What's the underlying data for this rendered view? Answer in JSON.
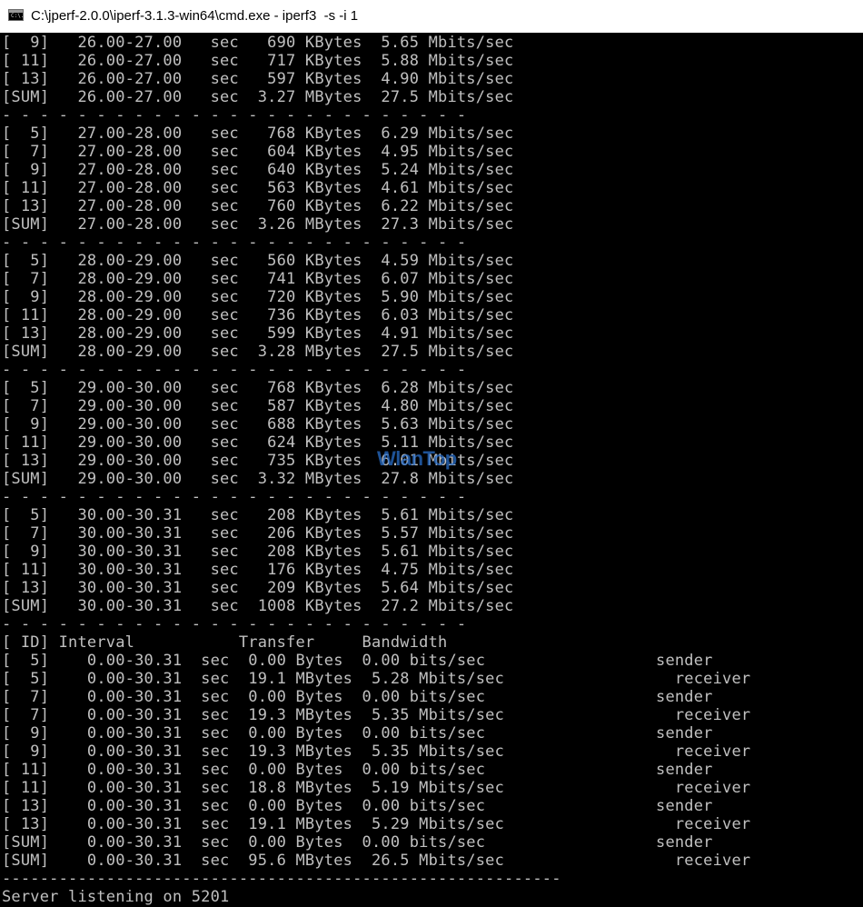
{
  "window": {
    "title": "C:\\jperf-2.0.0\\iperf-3.1.3-win64\\cmd.exe - iperf3  -s -i 1",
    "icon": "cmd-console-icon",
    "icon_glyph": "C:\\."
  },
  "watermark": "WlanTop",
  "console": {
    "lines": [
      "[  9]   26.00-27.00   sec   690 KBytes  5.65 Mbits/sec",
      "[ 11]   26.00-27.00   sec   717 KBytes  5.88 Mbits/sec",
      "[ 13]   26.00-27.00   sec   597 KBytes  4.90 Mbits/sec",
      "[SUM]   26.00-27.00   sec  3.27 MBytes  27.5 Mbits/sec",
      "- - - - - - - - - - - - - - - - - - - - - - - - -",
      "[  5]   27.00-28.00   sec   768 KBytes  6.29 Mbits/sec",
      "[  7]   27.00-28.00   sec   604 KBytes  4.95 Mbits/sec",
      "[  9]   27.00-28.00   sec   640 KBytes  5.24 Mbits/sec",
      "[ 11]   27.00-28.00   sec   563 KBytes  4.61 Mbits/sec",
      "[ 13]   27.00-28.00   sec   760 KBytes  6.22 Mbits/sec",
      "[SUM]   27.00-28.00   sec  3.26 MBytes  27.3 Mbits/sec",
      "- - - - - - - - - - - - - - - - - - - - - - - - -",
      "[  5]   28.00-29.00   sec   560 KBytes  4.59 Mbits/sec",
      "[  7]   28.00-29.00   sec   741 KBytes  6.07 Mbits/sec",
      "[  9]   28.00-29.00   sec   720 KBytes  5.90 Mbits/sec",
      "[ 11]   28.00-29.00   sec   736 KBytes  6.03 Mbits/sec",
      "[ 13]   28.00-29.00   sec   599 KBytes  4.91 Mbits/sec",
      "[SUM]   28.00-29.00   sec  3.28 MBytes  27.5 Mbits/sec",
      "- - - - - - - - - - - - - - - - - - - - - - - - -",
      "[  5]   29.00-30.00   sec   768 KBytes  6.28 Mbits/sec",
      "[  7]   29.00-30.00   sec   587 KBytes  4.80 Mbits/sec",
      "[  9]   29.00-30.00   sec   688 KBytes  5.63 Mbits/sec",
      "[ 11]   29.00-30.00   sec   624 KBytes  5.11 Mbits/sec",
      "[ 13]   29.00-30.00   sec   735 KBytes  6.01 Mbits/sec",
      "[SUM]   29.00-30.00   sec  3.32 MBytes  27.8 Mbits/sec",
      "- - - - - - - - - - - - - - - - - - - - - - - - -",
      "[  5]   30.00-30.31   sec   208 KBytes  5.61 Mbits/sec",
      "[  7]   30.00-30.31   sec   206 KBytes  5.57 Mbits/sec",
      "[  9]   30.00-30.31   sec   208 KBytes  5.61 Mbits/sec",
      "[ 11]   30.00-30.31   sec   176 KBytes  4.75 Mbits/sec",
      "[ 13]   30.00-30.31   sec   209 KBytes  5.64 Mbits/sec",
      "[SUM]   30.00-30.31   sec  1008 KBytes  27.2 Mbits/sec",
      "- - - - - - - - - - - - - - - - - - - - - - - - -",
      "[ ID] Interval           Transfer     Bandwidth",
      "[  5]    0.00-30.31  sec  0.00 Bytes  0.00 bits/sec                  sender",
      "[  5]    0.00-30.31  sec  19.1 MBytes  5.28 Mbits/sec                  receiver",
      "[  7]    0.00-30.31  sec  0.00 Bytes  0.00 bits/sec                  sender",
      "[  7]    0.00-30.31  sec  19.3 MBytes  5.35 Mbits/sec                  receiver",
      "[  9]    0.00-30.31  sec  0.00 Bytes  0.00 bits/sec                  sender",
      "[  9]    0.00-30.31  sec  19.3 MBytes  5.35 Mbits/sec                  receiver",
      "[ 11]    0.00-30.31  sec  0.00 Bytes  0.00 bits/sec                  sender",
      "[ 11]    0.00-30.31  sec  18.8 MBytes  5.19 Mbits/sec                  receiver",
      "[ 13]    0.00-30.31  sec  0.00 Bytes  0.00 bits/sec                  sender",
      "[ 13]    0.00-30.31  sec  19.1 MBytes  5.29 Mbits/sec                  receiver",
      "[SUM]    0.00-30.31  sec  0.00 Bytes  0.00 bits/sec                  sender",
      "[SUM]    0.00-30.31  sec  95.6 MBytes  26.5 Mbits/sec                  receiver",
      "-----------------------------------------------------------",
      "Server listening on 5201"
    ]
  }
}
